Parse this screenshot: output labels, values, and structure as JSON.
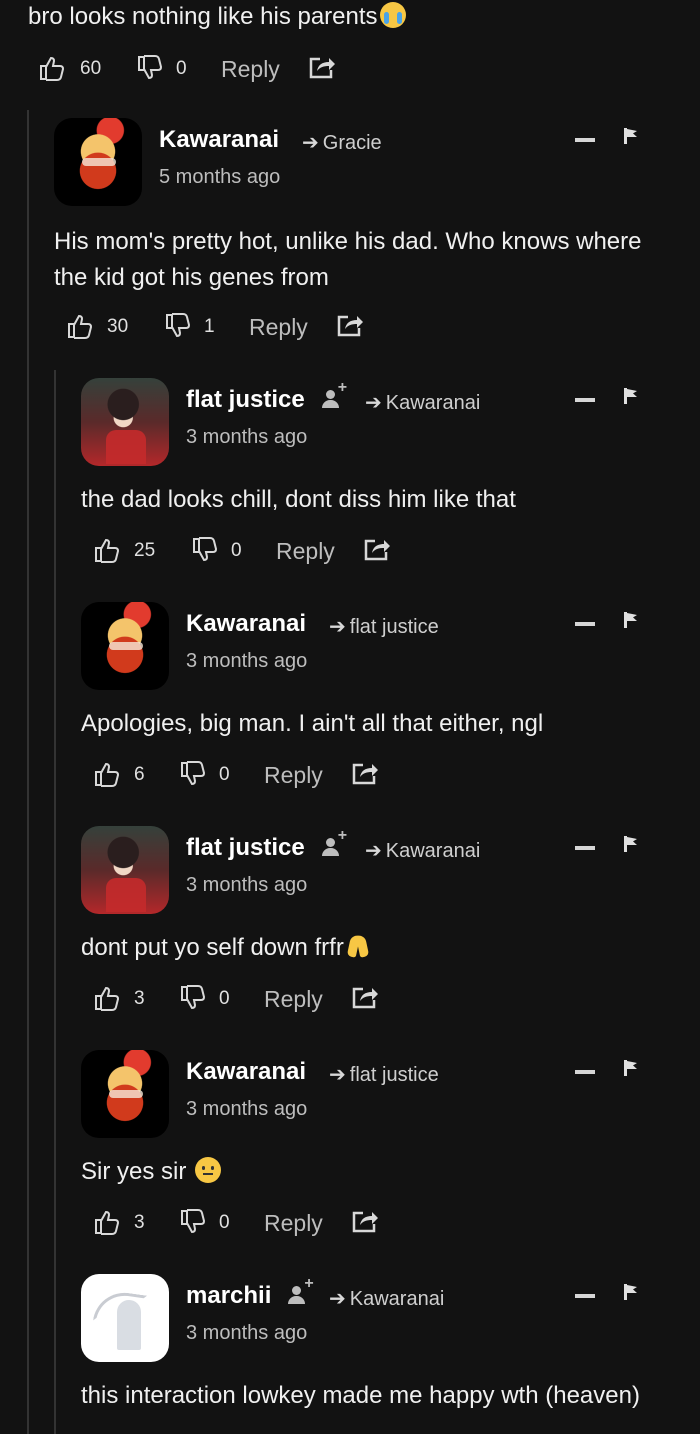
{
  "top_comment": {
    "text": "bro looks nothing like his parents",
    "likes": "60",
    "dislikes": "0",
    "reply_label": "Reply"
  },
  "icons": {
    "like": "thumbs-up-icon",
    "dislike": "thumbs-down-icon",
    "share": "share-icon",
    "collapse": "minus-icon",
    "report": "flag-icon",
    "reply_arrow": "arrow-right-icon",
    "follow": "add-person-icon"
  },
  "comments": [
    {
      "user": "Kawaranai",
      "replying_to": "Gracie",
      "time": "5 months ago",
      "text_lines": [
        "His mom's pretty hot, unlike his dad. Who knows where",
        "the kid got his genes from"
      ],
      "likes": "30",
      "dislikes": "1",
      "reply_label": "Reply",
      "avatar": "kawaranai-avatar",
      "has_follow": false
    },
    {
      "user": "flat justice",
      "replying_to": "Kawaranai",
      "time": "3 months ago",
      "text_lines": [
        "the dad looks chill, dont diss him like that"
      ],
      "likes": "25",
      "dislikes": "0",
      "reply_label": "Reply",
      "avatar": "flat-justice-avatar",
      "has_follow": true
    },
    {
      "user": "Kawaranai",
      "replying_to": "flat justice",
      "time": "3 months ago",
      "text_lines": [
        "Apologies, big man. I ain't all that either, ngl"
      ],
      "likes": "6",
      "dislikes": "0",
      "reply_label": "Reply",
      "avatar": "kawaranai-avatar",
      "has_follow": false
    },
    {
      "user": "flat justice",
      "replying_to": "Kawaranai",
      "time": "3 months ago",
      "text_lines": [
        "dont put yo self down frfr"
      ],
      "likes": "3",
      "dislikes": "0",
      "reply_label": "Reply",
      "avatar": "flat-justice-avatar",
      "has_follow": true
    },
    {
      "user": "Kawaranai",
      "replying_to": "flat justice",
      "time": "3 months ago",
      "text_lines": [
        "Sir yes sir"
      ],
      "likes": "3",
      "dislikes": "0",
      "reply_label": "Reply",
      "avatar": "kawaranai-avatar",
      "has_follow": false
    },
    {
      "user": "marchii",
      "replying_to": "Kawaranai",
      "time": "3 months ago",
      "text_lines": [
        "this interaction lowkey made me happy wth (heaven)"
      ],
      "likes": "",
      "dislikes": "",
      "reply_label": "",
      "avatar": "marchii-avatar",
      "has_follow": true
    }
  ]
}
